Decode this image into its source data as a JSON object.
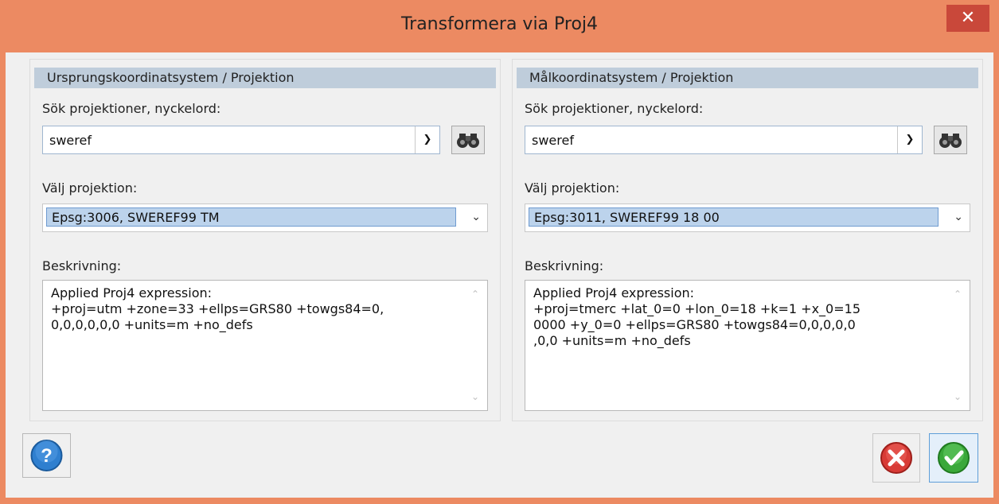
{
  "window": {
    "title": "Transformera via Proj4",
    "close_label": "✕"
  },
  "source": {
    "header": "Ursprungskoordinatsystem / Projektion",
    "search_label": "Sök projektioner, nyckelord:",
    "search_value": "sweref",
    "choose_label": "Välj projektion:",
    "selected_projection": "Epsg:3006, SWEREF99 TM",
    "description_label": "Beskrivning:",
    "description": "Applied Proj4 expression:\n+proj=utm +zone=33 +ellps=GRS80 +towgs84=0,\n0,0,0,0,0,0 +units=m +no_defs"
  },
  "target": {
    "header": "Målkoordinatsystem / Projektion",
    "search_label": "Sök projektioner, nyckelord:",
    "search_value": "sweref",
    "choose_label": "Välj projektion:",
    "selected_projection": "Epsg:3011, SWEREF99 18 00",
    "description_label": "Beskrivning:",
    "description": "Applied Proj4 expression:\n+proj=tmerc +lat_0=0 +lon_0=18 +k=1 +x_0=15\n0000 +y_0=0 +ellps=GRS80 +towgs84=0,0,0,0,0\n,0,0 +units=m +no_defs"
  },
  "icons": {
    "dropdown_arrow": "chevron-down-icon",
    "search": "binoculars-icon",
    "help": "help-icon",
    "cancel": "cancel-icon",
    "ok": "ok-icon"
  },
  "colors": {
    "window_frame": "#ec8a62",
    "close_button": "#c9483a",
    "panel_header": "#bfcddb",
    "selection": "#bcd3ec",
    "help_blue": "#2f7fcf",
    "cancel_red": "#d83b36",
    "ok_green": "#3aa83a"
  }
}
